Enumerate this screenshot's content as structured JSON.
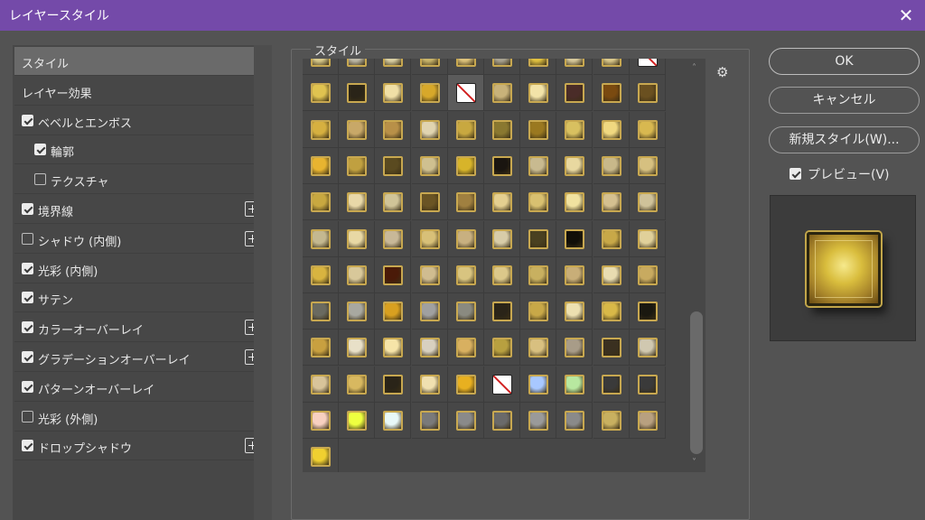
{
  "window": {
    "title": "レイヤースタイル",
    "close_symbol": "✕"
  },
  "left_panel": {
    "items": [
      {
        "label": "スタイル",
        "checkbox": null,
        "checked": false,
        "indent": 0,
        "plus": false,
        "selected": true
      },
      {
        "label": "レイヤー効果",
        "checkbox": null,
        "checked": false,
        "indent": 0,
        "plus": false,
        "selected": false
      },
      {
        "label": "ベベルとエンボス",
        "checkbox": true,
        "checked": true,
        "indent": 0,
        "plus": false,
        "selected": false
      },
      {
        "label": "輪郭",
        "checkbox": true,
        "checked": true,
        "indent": 1,
        "plus": false,
        "selected": false
      },
      {
        "label": "テクスチャ",
        "checkbox": true,
        "checked": false,
        "indent": 1,
        "plus": false,
        "selected": false
      },
      {
        "label": "境界線",
        "checkbox": true,
        "checked": true,
        "indent": 0,
        "plus": true,
        "selected": false
      },
      {
        "label": "シャドウ (内側)",
        "checkbox": true,
        "checked": false,
        "indent": 0,
        "plus": true,
        "selected": false
      },
      {
        "label": "光彩 (内側)",
        "checkbox": true,
        "checked": true,
        "indent": 0,
        "plus": false,
        "selected": false
      },
      {
        "label": "サテン",
        "checkbox": true,
        "checked": true,
        "indent": 0,
        "plus": false,
        "selected": false
      },
      {
        "label": "カラーオーバーレイ",
        "checkbox": true,
        "checked": true,
        "indent": 0,
        "plus": true,
        "selected": false
      },
      {
        "label": "グラデーションオーバーレイ",
        "checkbox": true,
        "checked": true,
        "indent": 0,
        "plus": true,
        "selected": false
      },
      {
        "label": "パターンオーバーレイ",
        "checkbox": true,
        "checked": true,
        "indent": 0,
        "plus": false,
        "selected": false
      },
      {
        "label": "光彩 (外側)",
        "checkbox": true,
        "checked": false,
        "indent": 0,
        "plus": false,
        "selected": false
      },
      {
        "label": "ドロップシャドウ",
        "checkbox": true,
        "checked": true,
        "indent": 0,
        "plus": true,
        "selected": false
      }
    ]
  },
  "styles_group": {
    "label": "スタイル",
    "gear_symbol": "⚙",
    "scroll_up": "˄",
    "scroll_down": "˅",
    "swatches": [
      [
        "#d8c98a",
        "#bdb8a6",
        "#d9cfa2",
        "#c9b46a",
        "#ddc27a",
        "#a8a290",
        "#e0c040",
        "#d6c89a",
        "#d9c78a",
        "#ffffff"
      ],
      [
        "#e0c350",
        "#2a2418",
        "#f0dfa6",
        "#d7a82a",
        "#ffffff",
        "#c8b27a",
        "#f2e3a8",
        "#4a2c28",
        "#7a4a10",
        "#6a5020"
      ],
      [
        "#d6b040",
        "#c8a868",
        "#b89048",
        "#e0d4b0",
        "#c8a840",
        "#8a7830",
        "#9a7820",
        "#d8c060",
        "#f0d880",
        "#d8b850"
      ],
      [
        "#e8b430",
        "#c0a040",
        "#5a4a20",
        "#cfc090",
        "#d7b42a",
        "#1a1510",
        "#c8ba90",
        "#e8d8a0",
        "#c8b88a",
        "#d6c080"
      ],
      [
        "#c8a840",
        "#e8d8a8",
        "#d0c498",
        "#6a5424",
        "#a08040",
        "#e4cf90",
        "#d8c070",
        "#f0e2a0",
        "#d4c090",
        "#cfc29a"
      ],
      [
        "#c4b890",
        "#e8d8a4",
        "#c8b898",
        "#d8c078",
        "#c8b080",
        "#d8cca8",
        "#4a4020",
        "#110e08",
        "#c8a848",
        "#e0d09a"
      ],
      [
        "#d8b440",
        "#d8c89a",
        "#4a1a08",
        "#d0bc90",
        "#d8c480",
        "#dcc88a",
        "#c8b060",
        "#c8ae78",
        "#e8dcb0",
        "#c8aa60"
      ],
      [
        "#6a6a60",
        "#a8a8a0",
        "#d8a020",
        "#a0a0a0",
        "#8a8a80",
        "#2a2418",
        "#c8a848",
        "#ece0b0",
        "#d8b848",
        "#1a1810"
      ],
      [
        "#c8a040",
        "#e8e0c8",
        "#f6e4a8",
        "#d8d0c0",
        "#d8b060",
        "#b8a040",
        "#d8c080",
        "#a89c88",
        "#3a3020",
        "#d0c8b0"
      ],
      [
        "#d8c49a",
        "#d8b860",
        "#2a2418",
        "#f0e0b0",
        "#e8b020",
        "#ffffff",
        "#a8c8ff",
        "#b8e8a0",
        "#3a3a3a",
        "#3a3a3a"
      ],
      [
        "#f8d0c0",
        "#eeff40",
        "#e8f8f8",
        "#7a7a7a",
        "#8a8a8a",
        "#6a6a6a",
        "#9a9a9a",
        "#8a8a8a",
        "#c8b060",
        "#b8a080"
      ],
      [
        "#f0d030"
      ]
    ]
  },
  "buttons": {
    "ok": "OK",
    "cancel": "キャンセル",
    "new_style": "新規スタイル(W)..."
  },
  "preview": {
    "label": "プレビュー(V)",
    "checked": true
  },
  "colors": {
    "title_bar": "#744aa9",
    "dialog_bg": "#535353",
    "panel_bg": "#474747"
  }
}
